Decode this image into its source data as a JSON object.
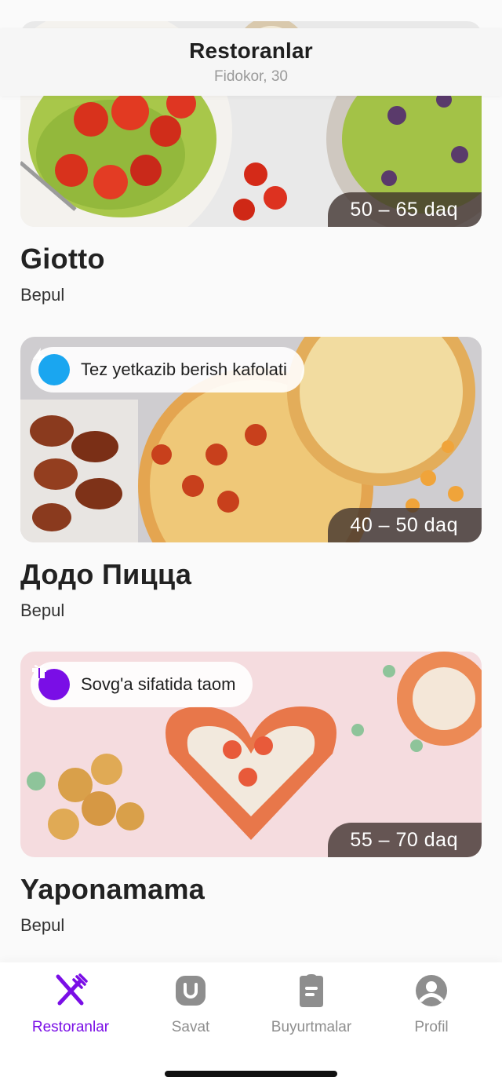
{
  "header": {
    "title": "Restoranlar",
    "subtitle": "Fidokor, 30"
  },
  "restaurants": [
    {
      "name": "Giotto",
      "delivery_fee": "Bepul",
      "time": "50 – 65 daq",
      "promo": null
    },
    {
      "name": "Додо Пицца",
      "delivery_fee": "Bepul",
      "time": "40 – 50 daq",
      "promo": {
        "label": "Tez yetkazib berish kafolati",
        "icon": "lightning-icon",
        "color": "#1aa6f0"
      }
    },
    {
      "name": "Yaponamama",
      "delivery_fee": "Bepul",
      "time": "55 – 70 daq",
      "promo": {
        "label": "Sovg'a sifatida taom",
        "icon": "gift-icon",
        "color": "#7a0ee6"
      }
    }
  ],
  "tabbar": {
    "items": [
      {
        "label": "Restoranlar",
        "icon": "fork-knife-icon",
        "active": true
      },
      {
        "label": "Savat",
        "icon": "basket-icon",
        "active": false
      },
      {
        "label": "Buyurtmalar",
        "icon": "receipt-icon",
        "active": false
      },
      {
        "label": "Profil",
        "icon": "user-icon",
        "active": false
      }
    ]
  },
  "colors": {
    "accent": "#7a0ee6",
    "inactive": "#8e8e8e",
    "lightning": "#1aa6f0"
  }
}
